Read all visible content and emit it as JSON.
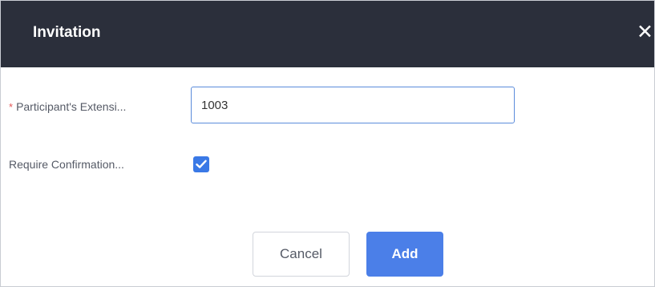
{
  "dialog": {
    "title": "Invitation",
    "close_icon": "close-icon"
  },
  "form": {
    "extension": {
      "label": "Participant's Extensi...",
      "required_mark": "*",
      "value": "1003"
    },
    "confirmation": {
      "label": "Require Confirmation...",
      "checked": true,
      "check_icon": "checkmark-icon"
    }
  },
  "buttons": {
    "cancel_label": "Cancel",
    "add_label": "Add"
  },
  "colors": {
    "header_bg": "#2b2f3b",
    "accent": "#4b7fe8",
    "required": "#e45858"
  }
}
